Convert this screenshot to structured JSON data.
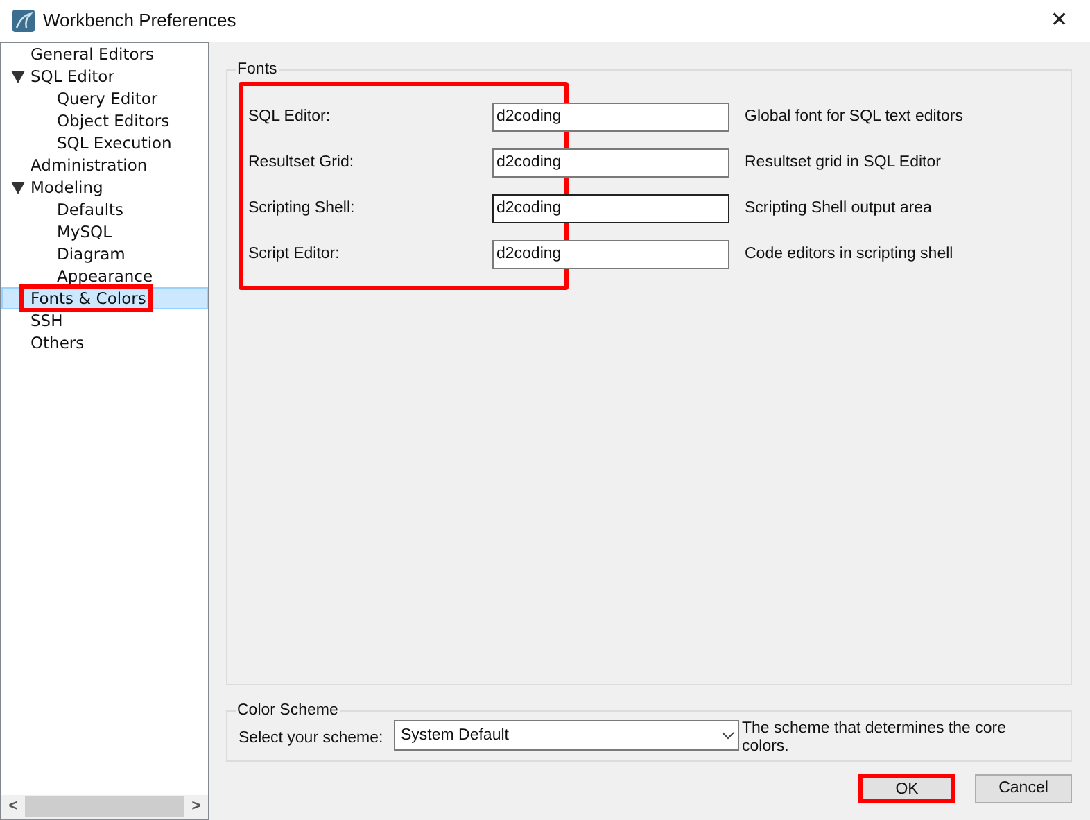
{
  "window": {
    "title": "Workbench Preferences",
    "close": "✕"
  },
  "sidebar": {
    "items": [
      {
        "label": "General Editors",
        "selected": false,
        "highlighted": false
      },
      {
        "label": "SQL Editor",
        "selected": false,
        "highlighted": false,
        "expanded": true,
        "children": [
          {
            "label": "Query Editor",
            "selected": false,
            "highlighted": false
          },
          {
            "label": "Object Editors",
            "selected": false,
            "highlighted": false
          },
          {
            "label": "SQL Execution",
            "selected": false,
            "highlighted": false
          }
        ]
      },
      {
        "label": "Administration",
        "selected": false,
        "highlighted": false
      },
      {
        "label": "Modeling",
        "selected": false,
        "highlighted": false,
        "expanded": true,
        "children": [
          {
            "label": "Defaults",
            "selected": false,
            "highlighted": false
          },
          {
            "label": "MySQL",
            "selected": false,
            "highlighted": false
          },
          {
            "label": "Diagram",
            "selected": false,
            "highlighted": false
          },
          {
            "label": "Appearance",
            "selected": false,
            "highlighted": false
          }
        ]
      },
      {
        "label": "Fonts & Colors",
        "selected": true,
        "highlighted": true
      },
      {
        "label": "SSH",
        "selected": false,
        "highlighted": false
      },
      {
        "label": "Others",
        "selected": false,
        "highlighted": false
      }
    ]
  },
  "fonts": {
    "title": "Fonts",
    "highlighted": true,
    "rows": [
      {
        "label": "SQL Editor:",
        "value": "d2coding",
        "description": "Global font for SQL text editors",
        "focused": false
      },
      {
        "label": "Resultset Grid:",
        "value": "d2coding",
        "description": "Resultset grid in SQL Editor",
        "focused": false
      },
      {
        "label": "Scripting Shell:",
        "value": "d2coding",
        "description": "Scripting Shell output area",
        "focused": true
      },
      {
        "label": "Script Editor:",
        "value": "d2coding",
        "description": "Code editors in scripting shell",
        "focused": false
      }
    ]
  },
  "color_scheme": {
    "title": "Color Scheme",
    "label": "Select your scheme:",
    "value": "System Default",
    "description": "The scheme that determines the core colors."
  },
  "buttons": [
    {
      "label": "OK",
      "highlighted": true
    },
    {
      "label": "Cancel",
      "highlighted": false
    }
  ],
  "scroll_left": "<",
  "scroll_right": ">"
}
